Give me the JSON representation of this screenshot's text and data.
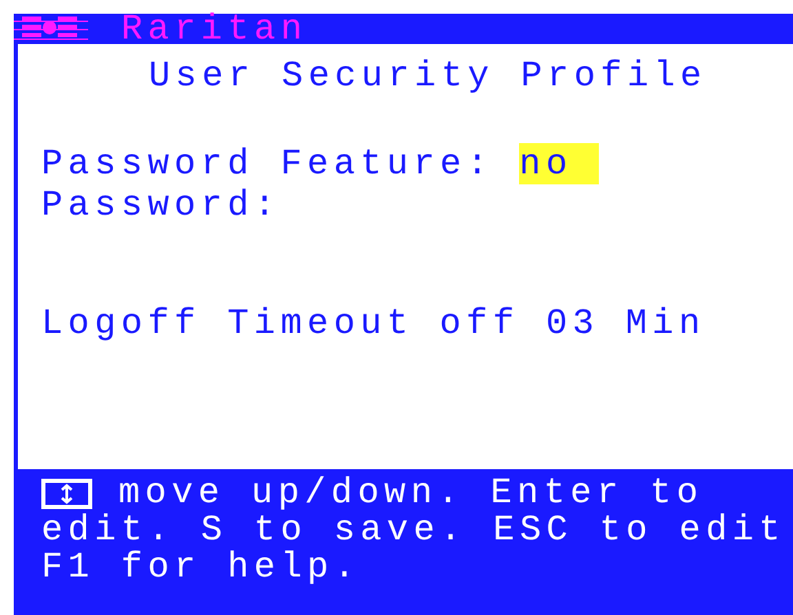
{
  "title_bar": {
    "brand": "Raritan"
  },
  "heading": "User Security Profile",
  "fields": [
    {
      "kind": "choice",
      "label": "Password Feature:",
      "value": "no",
      "selected": true
    },
    {
      "kind": "text",
      "label": "Password:"
    }
  ],
  "timeout": {
    "label": "Logoff Timeout",
    "value": "off 03 Min"
  },
  "help": {
    "lines": [
      "move up/down. Enter to",
      "edit. S to save. ESC to edit",
      "F1 for help."
    ]
  }
}
